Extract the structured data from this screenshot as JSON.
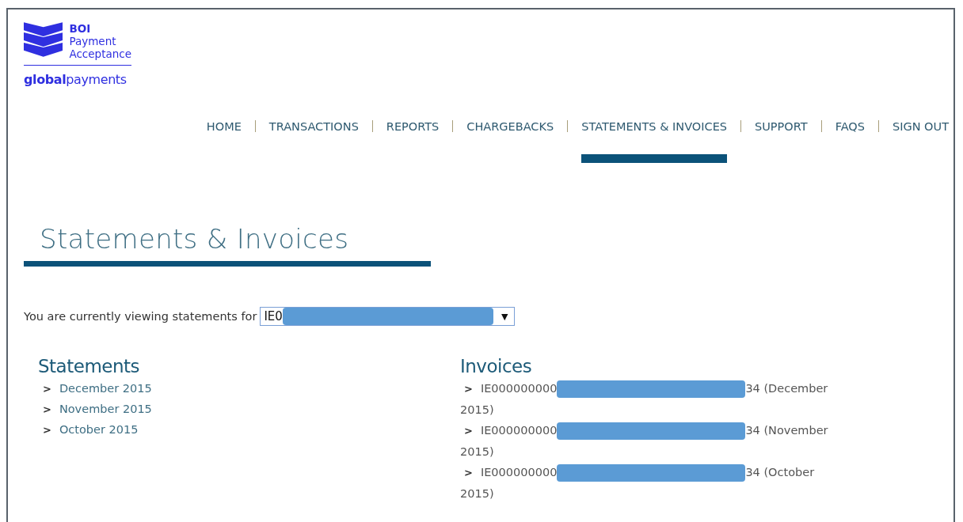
{
  "logo": {
    "brand": "BOI",
    "line_1": "Payment",
    "line_2": "Acceptance",
    "company": "**global**payments"
  },
  "nav": [
    {
      "label": "HOME",
      "selected": false
    },
    {
      "label": "TRANSACTIONS",
      "selected": false
    },
    {
      "label": "REPORTS",
      "selected": false
    },
    {
      "label": "CHARGEBACKS",
      "selected": false
    },
    {
      "label": "STATEMENTS & INVOICES",
      "selected": true
    },
    {
      "label": "SUPPORT",
      "selected": false
    },
    {
      "label": "FAQS",
      "selected": false
    },
    {
      "label": "SIGN OUT",
      "selected": false
    }
  ],
  "page_title": "Statements & Invoices",
  "selector": {
    "label": "You are currently viewing statements for",
    "value": "IE0",
    "caret": "▼"
  },
  "statements": {
    "title": "Statements",
    "items": [
      {
        "marker": ">",
        "label": "December 2015"
      },
      {
        "marker": ">",
        "label": "November 2015"
      },
      {
        "marker": ">",
        "label": "October 2015"
      }
    ]
  },
  "invoices": {
    "title": "Invoices",
    "items": [
      {
        "marker": ">",
        "prefix": "IE000000000",
        "suffix": "34 (December",
        "continuation": "2015)"
      },
      {
        "marker": ">",
        "prefix": "IE000000000",
        "suffix": "34 (November",
        "continuation": "2015)"
      },
      {
        "marker": ">",
        "prefix": "IE000000000",
        "suffix": "34 (October",
        "continuation": "2015)"
      }
    ]
  }
}
